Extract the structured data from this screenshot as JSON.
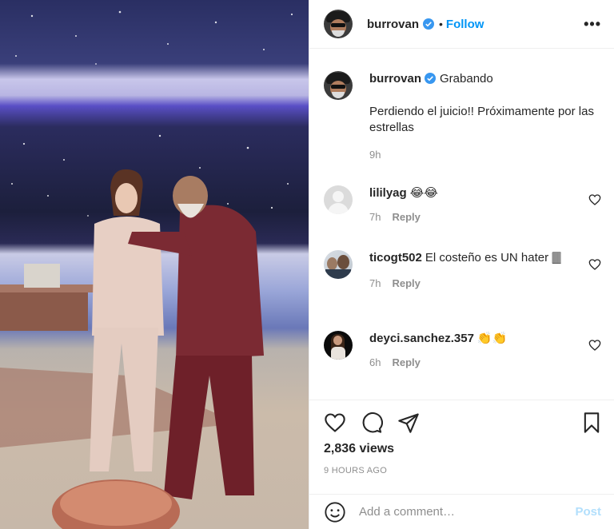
{
  "post": {
    "author": "burrovan",
    "verified": true,
    "follow_label": "Follow",
    "separator": "•",
    "more_label": "•••",
    "caption_username": "burrovan",
    "caption_location": "Grabando",
    "caption_text": "Perdiendo el juicio!! Próximamente por las estrellas",
    "caption_time": "9h"
  },
  "comments": [
    {
      "username": "lililyag",
      "text": "😂😂",
      "time": "7h",
      "reply_label": "Reply"
    },
    {
      "username": "ticogt502",
      "text": "El costeño es UN hater 🀫",
      "time": "7h",
      "reply_label": "Reply"
    },
    {
      "username": "deyci.sanchez.357",
      "text": "👏👏",
      "time": "6h",
      "reply_label": "Reply"
    }
  ],
  "stats": {
    "views": "2,836 views",
    "time_ago": "9 HOURS AGO"
  },
  "add_comment": {
    "placeholder": "Add a comment…",
    "post_label": "Post"
  },
  "icons": {
    "header_avatar": "avatar-icon",
    "verified": "verified-badge-icon",
    "like": "heart-icon",
    "comment": "comment-icon",
    "share": "paper-plane-icon",
    "save": "bookmark-icon",
    "emoji": "emoji-icon",
    "comment_like": "heart-small-icon"
  },
  "colors": {
    "accent": "#0095f6",
    "post_disabled": "#b2dffc",
    "muted": "#8e8e8e",
    "text": "#262626"
  }
}
